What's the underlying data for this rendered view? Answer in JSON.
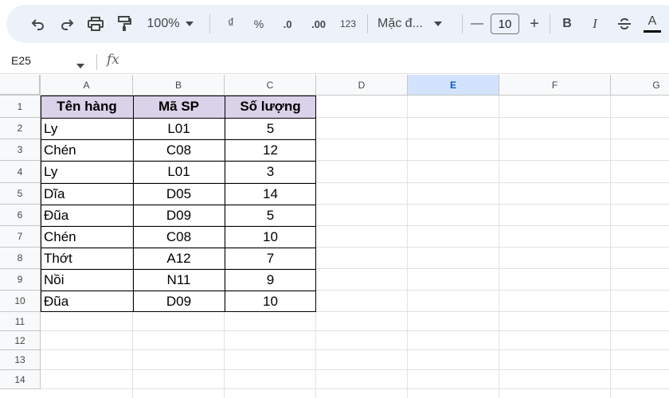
{
  "toolbar": {
    "zoom": "100%",
    "currency": "₫",
    "percent": "%",
    "dec_decrease": ".0",
    "dec_increase": ".00",
    "number_format": "123",
    "font_name": "Mặc đ...",
    "font_size": "10",
    "font_minus": "—",
    "font_plus": "+",
    "bold": "B",
    "italic": "I",
    "text_color": "A"
  },
  "formula_bar": {
    "name_box": "E25",
    "fx": "fx",
    "formula": ""
  },
  "grid": {
    "columns": [
      "A",
      "B",
      "C",
      "D",
      "E",
      "F",
      "G"
    ],
    "selected_column": "E",
    "rows": [
      "1",
      "2",
      "3",
      "4",
      "5",
      "6",
      "7",
      "8",
      "9",
      "10",
      "11",
      "12",
      "13",
      "14"
    ]
  },
  "table": {
    "headers": [
      "Tên hàng",
      "Mã SP",
      "Số lượng"
    ],
    "rows": [
      [
        "Ly",
        "L01",
        "5"
      ],
      [
        "Chén",
        "C08",
        "12"
      ],
      [
        "Ly",
        "L01",
        "3"
      ],
      [
        "Dĩa",
        "D05",
        "14"
      ],
      [
        "Đũa",
        "D09",
        "5"
      ],
      [
        "Chén",
        "C08",
        "10"
      ],
      [
        "Thớt",
        "A12",
        "7"
      ],
      [
        "Nồi",
        "N11",
        "9"
      ],
      [
        "Đũa",
        "D09",
        "10"
      ]
    ],
    "header_color": "#d9d2e9"
  },
  "colors": {
    "toolbar_bg": "#edf2fa",
    "selected_header": "#d3e3fd",
    "selected_header_text": "#0b57d0"
  }
}
